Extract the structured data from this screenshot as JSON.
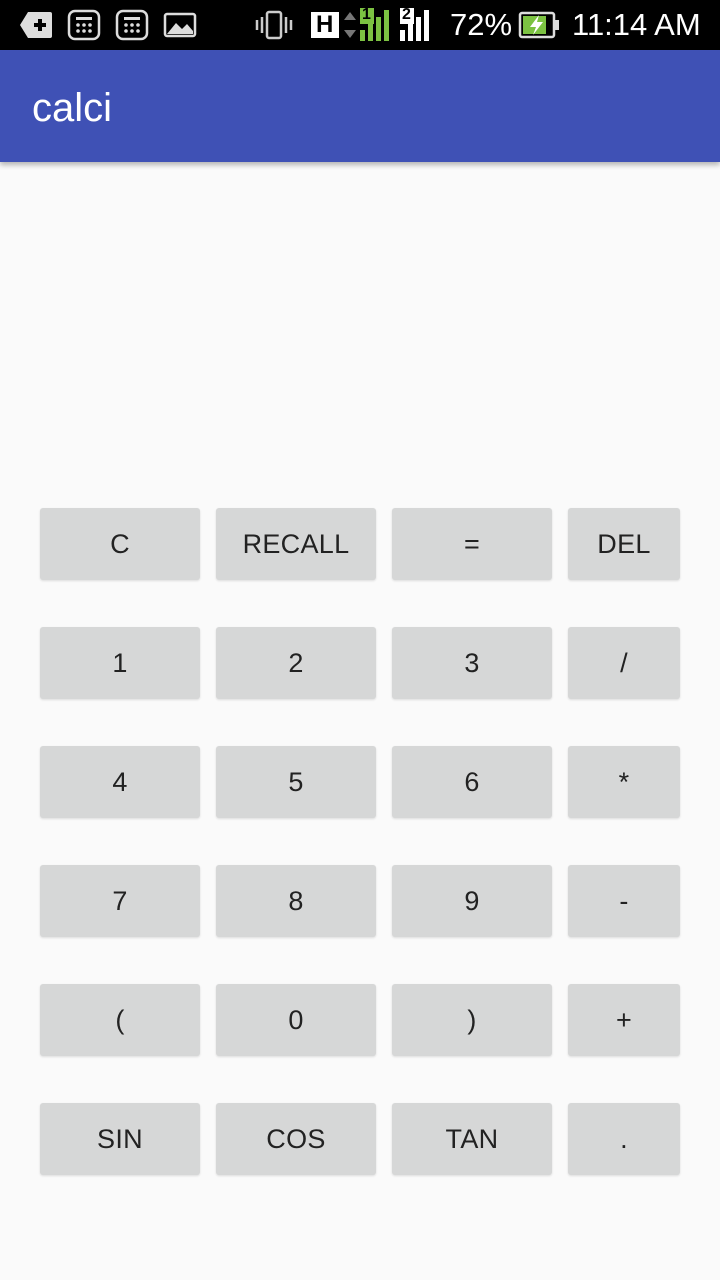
{
  "status_bar": {
    "icons": [
      "add-notification-icon",
      "calculator-app-icon",
      "calculator-app-icon",
      "image-gallery-icon",
      "vibrate-icon",
      "hspa-network-icon",
      "signal-sim1-icon",
      "signal-sim2-icon",
      "battery-charging-icon"
    ],
    "network_type": "H",
    "sim1_label": "1",
    "sim2_label": "2",
    "battery_percent": "72%",
    "time": "11:14 AM"
  },
  "app_bar": {
    "title": "calci",
    "color": "#3f51b5"
  },
  "display": {
    "value": ""
  },
  "keypad": {
    "rows": [
      [
        "C",
        "RECALL",
        "=",
        "DEL"
      ],
      [
        "1",
        "2",
        "3",
        "/"
      ],
      [
        "4",
        "5",
        "6",
        "*"
      ],
      [
        "7",
        "8",
        "9",
        "-"
      ],
      [
        "(",
        "0",
        ")",
        "+"
      ],
      [
        "SIN",
        "COS",
        "TAN",
        "."
      ]
    ],
    "button_color": "#d6d7d7"
  }
}
